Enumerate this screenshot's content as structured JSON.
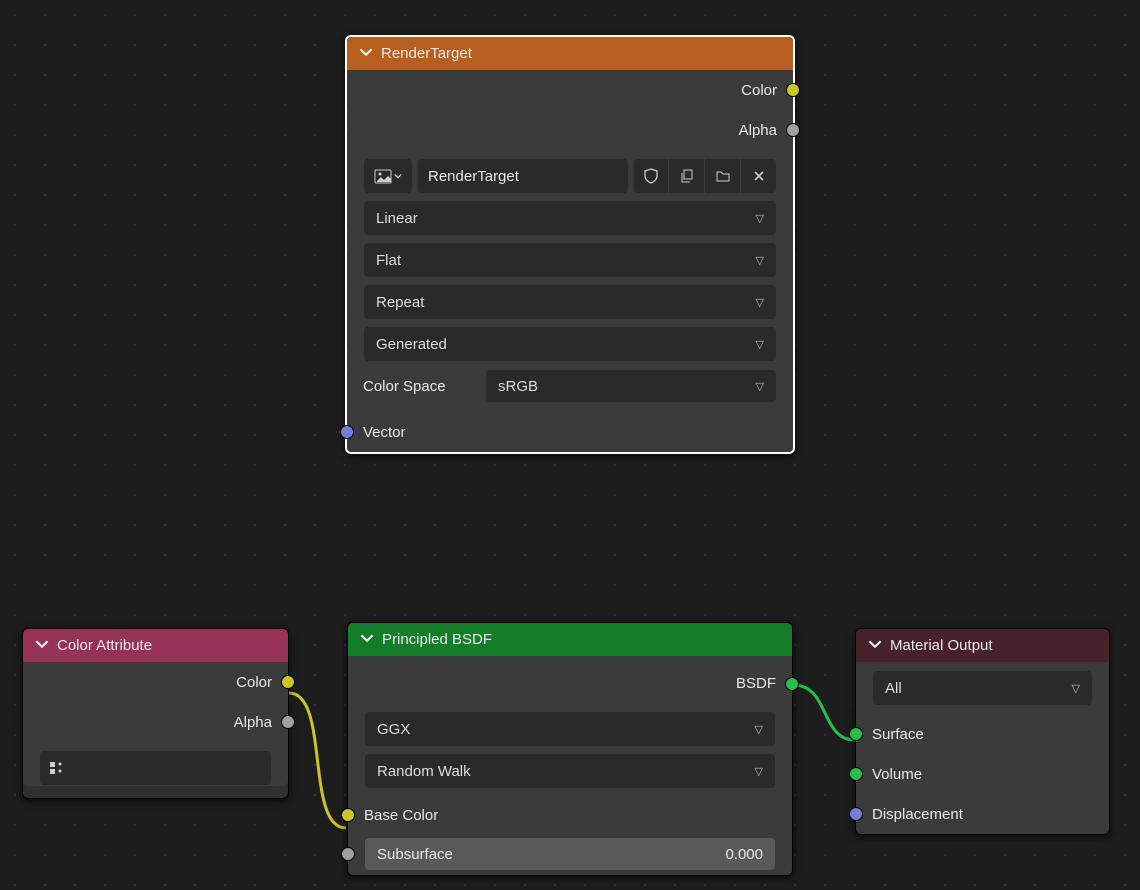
{
  "renderTarget": {
    "title": "RenderTarget",
    "outputs": {
      "color": "Color",
      "alpha": "Alpha"
    },
    "texName": "RenderTarget",
    "interp": "Linear",
    "projection": "Flat",
    "extension": "Repeat",
    "coords": "Generated",
    "colorSpaceLabel": "Color Space",
    "colorSpace": "sRGB",
    "inputs": {
      "vector": "Vector"
    }
  },
  "colorAttribute": {
    "title": "Color Attribute",
    "outputs": {
      "color": "Color",
      "alpha": "Alpha"
    }
  },
  "principled": {
    "title": "Principled BSDF",
    "outputs": {
      "bsdf": "BSDF"
    },
    "distribution": "GGX",
    "subsurfaceMethod": "Random Walk",
    "baseColorLabel": "Base Color",
    "subsurfaceLabel": "Subsurface",
    "subsurfaceValue": "0.000"
  },
  "materialOutput": {
    "title": "Material Output",
    "target": "All",
    "inputs": {
      "surface": "Surface",
      "volume": "Volume",
      "displacement": "Displacement"
    }
  }
}
